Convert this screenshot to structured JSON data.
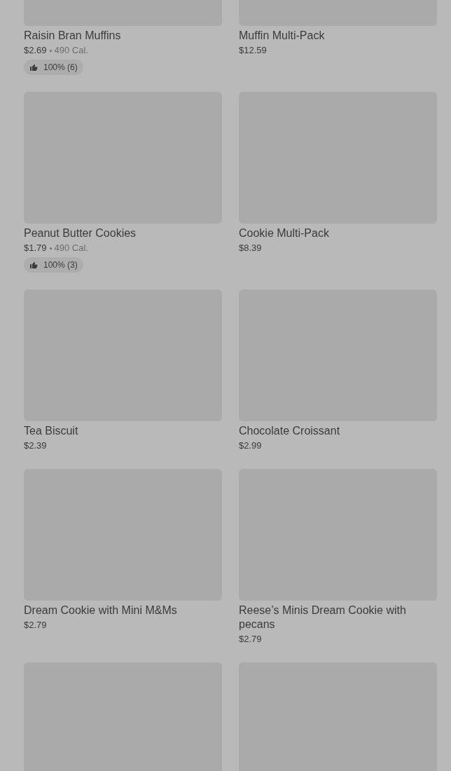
{
  "products": [
    {
      "kind": "placeholder",
      "name": "Raisin Bran Muffins",
      "price": "$2.69",
      "calories": "490 Cal.",
      "rating": "100% (6)"
    },
    {
      "kind": "placeholder",
      "name": "Muffin Multi-Pack",
      "price": "$12.59"
    },
    {
      "kind": "placeholder",
      "name": "Peanut Butter Cookies",
      "price": "$1.79",
      "calories": "490 Cal.",
      "rating": "100% (3)"
    },
    {
      "kind": "placeholder",
      "name": "Cookie Multi-Pack",
      "price": "$8.39"
    },
    {
      "kind": "placeholder",
      "name": "Tea Biscuit",
      "price": "$2.39"
    },
    {
      "kind": "placeholder",
      "name": "Chocolate Croissant",
      "price": "$2.99"
    },
    {
      "kind": "placeholder",
      "name": "Dream Cookie with Mini M&Ms",
      "price": "$2.79"
    },
    {
      "kind": "placeholder",
      "name": "Reese’s Minis Dream Cookie with pecans",
      "price": "$2.79"
    },
    {
      "kind": "placeholder"
    },
    {
      "kind": "placeholder"
    }
  ]
}
